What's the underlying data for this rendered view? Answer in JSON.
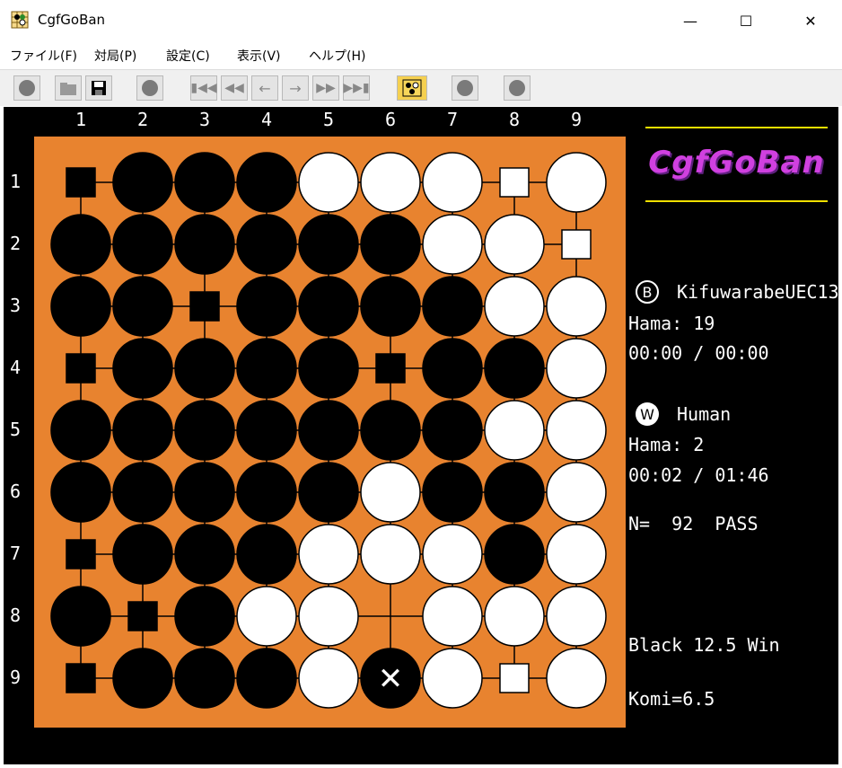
{
  "window": {
    "title": "CgfGoBan",
    "minimize": "—",
    "maximize": "☐",
    "close": "✕"
  },
  "menu": [
    {
      "label": "ファイル(F)"
    },
    {
      "label": "対局(P)"
    },
    {
      "label": "設定(C)"
    },
    {
      "label": "表示(V)"
    },
    {
      "label": "ヘルプ(H)"
    }
  ],
  "toolbar": [
    "new-game",
    "open",
    "save",
    "pass",
    "go-first",
    "back-10",
    "back-1",
    "forward-1",
    "forward-10",
    "go-last",
    "board-setup",
    "resign",
    "stop"
  ],
  "board": {
    "columns": [
      "1",
      "2",
      "3",
      "4",
      "5",
      "6",
      "7",
      "8",
      "9"
    ],
    "rows": [
      "1",
      "2",
      "3",
      "4",
      "5",
      "6",
      "7",
      "8",
      "9"
    ],
    "stones": [
      [
        "BT",
        "B",
        "B",
        "B",
        "W",
        "W",
        "W",
        "WT",
        "W"
      ],
      [
        "B",
        "B",
        "B",
        "B",
        "B",
        "B",
        "W",
        "W",
        "WT"
      ],
      [
        "B",
        "B",
        "BT",
        "B",
        "B",
        "B",
        "B",
        "W",
        "W"
      ],
      [
        "BT",
        "B",
        "B",
        "B",
        "B",
        "BT",
        "B",
        "B",
        "W"
      ],
      [
        "B",
        "B",
        "B",
        "B",
        "B",
        "B",
        "B",
        "W",
        "W"
      ],
      [
        "B",
        "B",
        "B",
        "B",
        "B",
        "W",
        "B",
        "B",
        "W"
      ],
      [
        "BT",
        "B",
        "B",
        "B",
        "W",
        "W",
        "W",
        "B",
        "W"
      ],
      [
        "B",
        "BT",
        "B",
        "W",
        "W",
        "E",
        "W",
        "W",
        "W"
      ],
      [
        "BT",
        "B",
        "B",
        "B",
        "W",
        "B",
        "W",
        "WT",
        "W"
      ]
    ],
    "last_move_marker": "✕"
  },
  "logo": "CgfGoBan",
  "black": {
    "badge": "B",
    "name": "KifuwarabeUEC13",
    "hama": "Hama: 19",
    "time": "00:00 / 00:00"
  },
  "white": {
    "badge": "W",
    "name": "Human",
    "hama": "Hama: 2",
    "time": "00:02 / 01:46"
  },
  "move_info": "N=  92  PASS",
  "result": "Black 12.5 Win",
  "komi": "Komi=6.5",
  "colors": {
    "board": "#e8832f",
    "background": "#000000",
    "logo": "#d040e0",
    "logo_lines": "#f0e000"
  }
}
